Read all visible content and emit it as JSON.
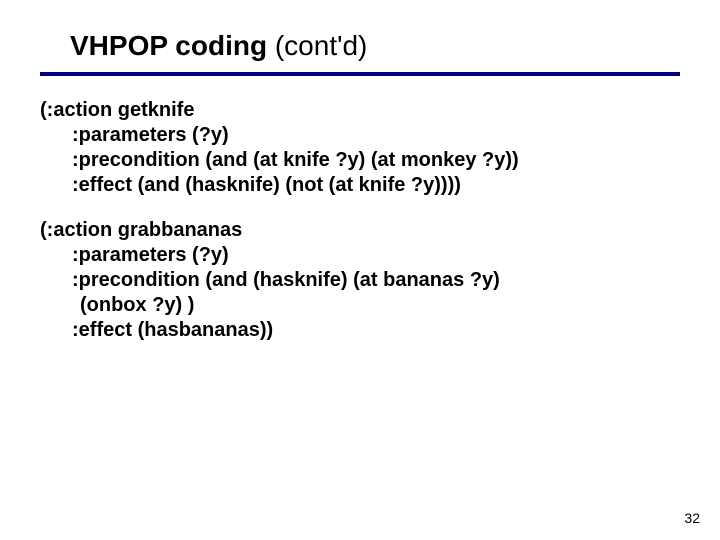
{
  "title": {
    "bold": "VHPOP coding",
    "rest": " (cont'd)"
  },
  "blocks": [
    {
      "lines": [
        "(:action getknife",
        ":parameters (?y)",
        ":precondition (and (at knife ?y) (at monkey ?y))",
        ":effect (and (hasknife) (not (at knife ?y))))"
      ]
    },
    {
      "lines": [
        "(:action grabbananas",
        ":parameters (?y)",
        ":precondition (and (hasknife) (at bananas ?y)",
        "(onbox ?y) )",
        ":effect (hasbananas))"
      ]
    }
  ],
  "page_number": "32"
}
